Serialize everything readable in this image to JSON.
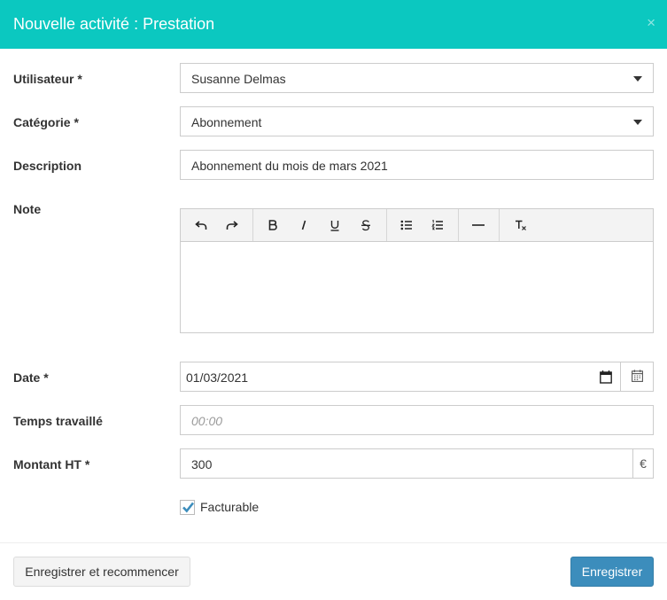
{
  "modal": {
    "title": "Nouvelle activité : Prestation",
    "close_symbol": "×"
  },
  "form": {
    "user": {
      "label": "Utilisateur *",
      "value": "Susanne Delmas"
    },
    "category": {
      "label": "Catégorie *",
      "value": "Abonnement"
    },
    "description": {
      "label": "Description",
      "value": "Abonnement du mois de mars 2021"
    },
    "note": {
      "label": "Note",
      "toolbar": [
        "undo-icon",
        "redo-icon",
        "bold-icon",
        "italic-icon",
        "underline-icon",
        "strikethrough-icon",
        "bullet-list-icon",
        "numbered-list-icon",
        "horizontal-rule-icon",
        "clear-format-icon"
      ]
    },
    "date": {
      "label": "Date *",
      "value": "01/03/2021"
    },
    "time": {
      "label": "Temps travaillé",
      "placeholder": "00:00"
    },
    "amount": {
      "label": "Montant HT *",
      "value": "300",
      "currency": "€"
    },
    "billable": {
      "label": "Facturable",
      "checked": true
    }
  },
  "footer": {
    "save_and_restart_label": "Enregistrer et recommencer",
    "save_label": "Enregistrer"
  },
  "colors": {
    "header": "#0bc8c0",
    "primary": "#3c8dbc",
    "checkbox": "#3c8dbc"
  }
}
